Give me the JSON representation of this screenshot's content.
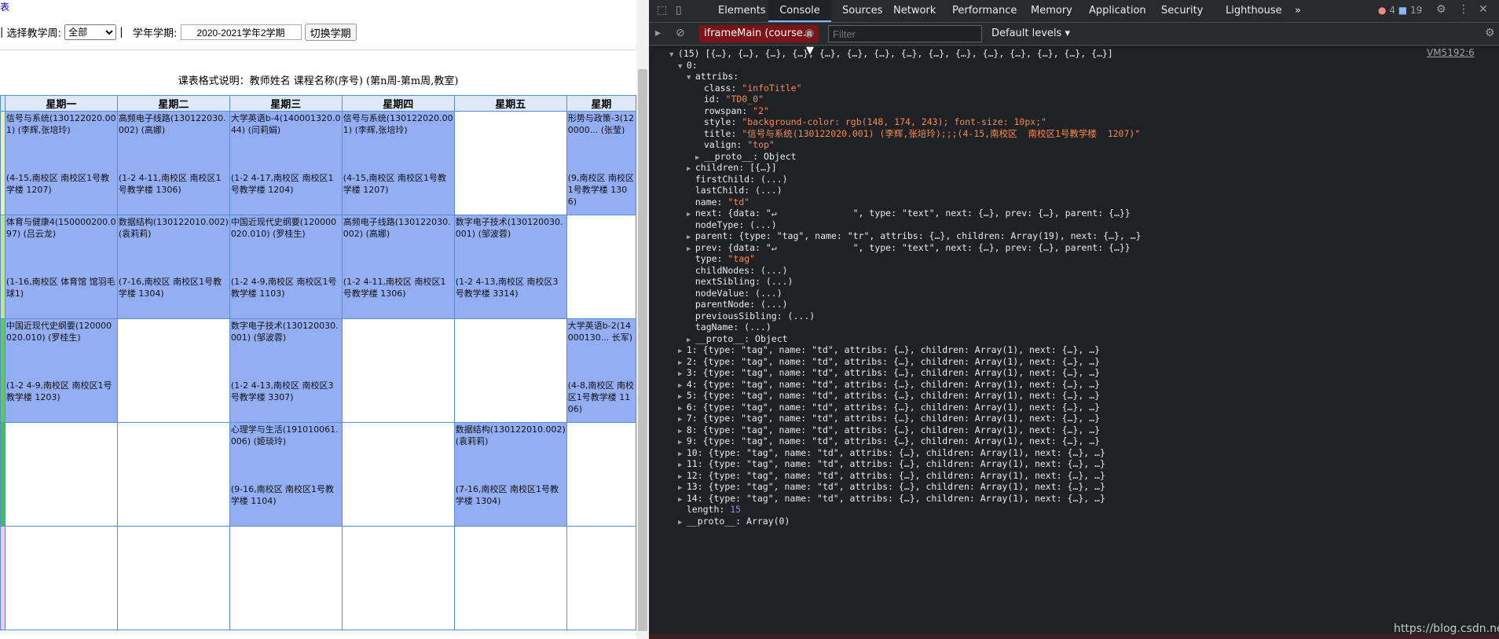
{
  "page": {
    "top_link": "表",
    "week_label": "选择教学周:",
    "week_value": "全部",
    "term_label": "学年学期:",
    "term_value": "2020-2021学年2学期",
    "switch_label": "切换学期",
    "format_note": "课表格式说明：教师姓名 课程名称(序号) (第n周-第m周,教室)"
  },
  "schedule": {
    "days": [
      "星期一",
      "星期二",
      "星期三",
      "星期四",
      "星期五",
      "星期"
    ],
    "rows": [
      [
        {
          "name": "信号与系统(130122020.001) (李辉,张培玲)",
          "time": "(4-15,南校区 南校区1号教学楼 1207)"
        },
        {
          "name": "高频电子线路(130122030.002) (高娜)",
          "time": "(1-2 4-11,南校区 南校区1号教学楼 1306)"
        },
        {
          "name": "大学英语b-4(140001320.044) (闫莉娟)",
          "time": "(1-2 4-17,南校区 南校区1号教学楼 1204)"
        },
        {
          "name": "信号与系统(130122020.001) (李辉,张培玲)",
          "time": "(4-15,南校区 南校区1号教学楼 1207)"
        },
        {
          "name": "",
          "time": ""
        },
        {
          "name": "形势与政策-3(120000... (张莹)",
          "time": "(9,南校区 南校区1号教学楼 1306)"
        }
      ],
      [
        {
          "name": "体育与健康4(150000200.097) (吕云龙)",
          "time": "(1-16,南校区 体育馆 馆羽毛球1)"
        },
        {
          "name": "数据结构(130122010.002) (袁莉莉)",
          "time": "(7-16,南校区 南校区1号教学楼 1304)"
        },
        {
          "name": "中国近现代史纲要(120000020.010) (罗桂生)",
          "time": "(1-2 4-9,南校区 南校区1号教学楼 1103)"
        },
        {
          "name": "高频电子线路(130122030.002) (高娜)",
          "time": "(1-2 4-11,南校区 南校区1号教学楼 1306)"
        },
        {
          "name": "数字电子技术(130120030.001) (邹波蓉)",
          "time": "(1-2 4-13,南校区 南校区3号教学楼 3314)"
        },
        {
          "name": "",
          "time": ""
        }
      ],
      [
        {
          "name": "中国近现代史纲要(120000020.010) (罗桂生)",
          "time": "(1-2 4-9,南校区 南校区1号教学楼 1203)"
        },
        {
          "name": "",
          "time": ""
        },
        {
          "name": "数字电子技术(130120030.001) (邹波蓉)",
          "time": "(1-2 4-13,南校区 南校区3号教学楼 3307)"
        },
        {
          "name": "",
          "time": ""
        },
        {
          "name": "",
          "time": ""
        },
        {
          "name": "大学英语b-2(14000130... 长军)",
          "time": "(4-8,南校区 南校区1号教学楼 1106)"
        }
      ],
      [
        {
          "name": "",
          "time": ""
        },
        {
          "name": "",
          "time": ""
        },
        {
          "name": "心理学与生活(191010061.006) (姬琰玲)",
          "time": "(9-16,南校区 南校区1号教学楼 1104)"
        },
        {
          "name": "",
          "time": ""
        },
        {
          "name": "数据结构(130122010.002) (袁莉莉)",
          "time": "(7-16,南校区 南校区1号教学楼 1304)"
        },
        {
          "name": "",
          "time": ""
        }
      ],
      [
        {
          "name": "",
          "time": ""
        },
        {
          "name": "",
          "time": ""
        },
        {
          "name": "",
          "time": ""
        },
        {
          "name": "",
          "time": ""
        },
        {
          "name": "",
          "time": ""
        },
        {
          "name": "",
          "time": ""
        }
      ]
    ]
  },
  "colors": {
    "course_fill": "#94aef3",
    "strip": [
      "#f0f0a0",
      "#c8e870",
      "#5ad23c",
      "#3cc83c",
      "#f8c8d8"
    ]
  },
  "devtools": {
    "tabs": [
      "Elements",
      "Console",
      "Sources",
      "Network",
      "Performance",
      "Memory",
      "Application",
      "Security",
      "Lighthouse"
    ],
    "active_tab": "Console",
    "more_tabs": "»",
    "error_count": "4",
    "message_count": "19",
    "context": "iframeMain (course...",
    "filter_placeholder": "Filter",
    "levels": "Default levels",
    "source_link": "VM5192:6",
    "watermark": "https://blog.csdn.net/hpuylx",
    "lines": [
      {
        "indent": 0,
        "tri": "▼",
        "text": "(15) [{…}, {…}, {…}, {…}, {…}, {…}, {…}, {…}, {…}, {…}, {…}, {…}, {…}, {…}, {…}]"
      },
      {
        "indent": 1,
        "tri": "▼",
        "text": "0:"
      },
      {
        "indent": 2,
        "tri": "▼",
        "text": "attribs:"
      },
      {
        "indent": 3,
        "tri": "",
        "key": "class: ",
        "val": "\"infoTitle\""
      },
      {
        "indent": 3,
        "tri": "",
        "key": "id: ",
        "val": "\"TD0_0\""
      },
      {
        "indent": 3,
        "tri": "",
        "key": "rowspan: ",
        "val": "\"2\""
      },
      {
        "indent": 3,
        "tri": "",
        "key": "style: ",
        "val": "\"background-color: rgb(148, 174, 243); font-size: 10px;\""
      },
      {
        "indent": 3,
        "tri": "",
        "key": "title: ",
        "val": "\"信号与系统(130122020.001) (李辉,张培玲);;;(4-15,南校区  南校区1号教学楼  1207)\""
      },
      {
        "indent": 3,
        "tri": "",
        "key": "valign: ",
        "val": "\"top\""
      },
      {
        "indent": 3,
        "tri": "▶",
        "key": "__proto__: ",
        "val2": "Object"
      },
      {
        "indent": 2,
        "tri": "▶",
        "key": "children: ",
        "val2": "[{…}]"
      },
      {
        "indent": 2,
        "tri": "",
        "key": "firstChild: ",
        "val2": "(...)"
      },
      {
        "indent": 2,
        "tri": "",
        "key": "lastChild: ",
        "val2": "(...)"
      },
      {
        "indent": 2,
        "tri": "",
        "key": "name: ",
        "val": "\"td\""
      },
      {
        "indent": 2,
        "tri": "▶",
        "key": "next: ",
        "val2": "{data: \"↵              \", type: \"text\", next: {…}, prev: {…}, parent: {…}}"
      },
      {
        "indent": 2,
        "tri": "",
        "key": "nodeType: ",
        "val2": "(...)"
      },
      {
        "indent": 2,
        "tri": "▶",
        "key": "parent: ",
        "val2": "{type: \"tag\", name: \"tr\", attribs: {…}, children: Array(19), next: {…}, …}"
      },
      {
        "indent": 2,
        "tri": "▶",
        "key": "prev: ",
        "val2": "{data: \"↵              \", type: \"text\", next: {…}, prev: {…}, parent: {…}}"
      },
      {
        "indent": 2,
        "tri": "",
        "key": "type: ",
        "val": "\"tag\""
      },
      {
        "indent": 2,
        "tri": "",
        "key": "childNodes: ",
        "val2": "(...)"
      },
      {
        "indent": 2,
        "tri": "",
        "key": "nextSibling: ",
        "val2": "(...)"
      },
      {
        "indent": 2,
        "tri": "",
        "key": "nodeValue: ",
        "val2": "(...)"
      },
      {
        "indent": 2,
        "tri": "",
        "key": "parentNode: ",
        "val2": "(...)"
      },
      {
        "indent": 2,
        "tri": "",
        "key": "previousSibling: ",
        "val2": "(...)"
      },
      {
        "indent": 2,
        "tri": "",
        "key": "tagName: ",
        "val2": "(...)"
      },
      {
        "indent": 2,
        "tri": "▶",
        "key": "__proto__: ",
        "val2": "Object"
      },
      {
        "indent": 1,
        "tri": "▶",
        "key": "1: ",
        "val2": "{type: \"tag\", name: \"td\", attribs: {…}, children: Array(1), next: {…}, …}"
      },
      {
        "indent": 1,
        "tri": "▶",
        "key": "2: ",
        "val2": "{type: \"tag\", name: \"td\", attribs: {…}, children: Array(1), next: {…}, …}"
      },
      {
        "indent": 1,
        "tri": "▶",
        "key": "3: ",
        "val2": "{type: \"tag\", name: \"td\", attribs: {…}, children: Array(1), next: {…}, …}"
      },
      {
        "indent": 1,
        "tri": "▶",
        "key": "4: ",
        "val2": "{type: \"tag\", name: \"td\", attribs: {…}, children: Array(1), next: {…}, …}"
      },
      {
        "indent": 1,
        "tri": "▶",
        "key": "5: ",
        "val2": "{type: \"tag\", name: \"td\", attribs: {…}, children: Array(1), next: {…}, …}"
      },
      {
        "indent": 1,
        "tri": "▶",
        "key": "6: ",
        "val2": "{type: \"tag\", name: \"td\", attribs: {…}, children: Array(1), next: {…}, …}"
      },
      {
        "indent": 1,
        "tri": "▶",
        "key": "7: ",
        "val2": "{type: \"tag\", name: \"td\", attribs: {…}, children: Array(1), next: {…}, …}"
      },
      {
        "indent": 1,
        "tri": "▶",
        "key": "8: ",
        "val2": "{type: \"tag\", name: \"td\", attribs: {…}, children: Array(1), next: {…}, …}"
      },
      {
        "indent": 1,
        "tri": "▶",
        "key": "9: ",
        "val2": "{type: \"tag\", name: \"td\", attribs: {…}, children: Array(1), next: {…}, …}"
      },
      {
        "indent": 1,
        "tri": "▶",
        "key": "10: ",
        "val2": "{type: \"tag\", name: \"td\", attribs: {…}, children: Array(1), next: {…}, …}"
      },
      {
        "indent": 1,
        "tri": "▶",
        "key": "11: ",
        "val2": "{type: \"tag\", name: \"td\", attribs: {…}, children: Array(1), next: {…}, …}"
      },
      {
        "indent": 1,
        "tri": "▶",
        "key": "12: ",
        "val2": "{type: \"tag\", name: \"td\", attribs: {…}, children: Array(1), next: {…}, …}"
      },
      {
        "indent": 1,
        "tri": "▶",
        "key": "13: ",
        "val2": "{type: \"tag\", name: \"td\", attribs: {…}, children: Array(1), next: {…}, …}"
      },
      {
        "indent": 1,
        "tri": "▶",
        "key": "14: ",
        "val2": "{type: \"tag\", name: \"td\", attribs: {…}, children: Array(1), next: {…}, …}"
      },
      {
        "indent": 1,
        "tri": "",
        "key": "length: ",
        "num": "15"
      },
      {
        "indent": 1,
        "tri": "▶",
        "key": "__proto__: ",
        "val2": "Array(0)"
      }
    ]
  }
}
